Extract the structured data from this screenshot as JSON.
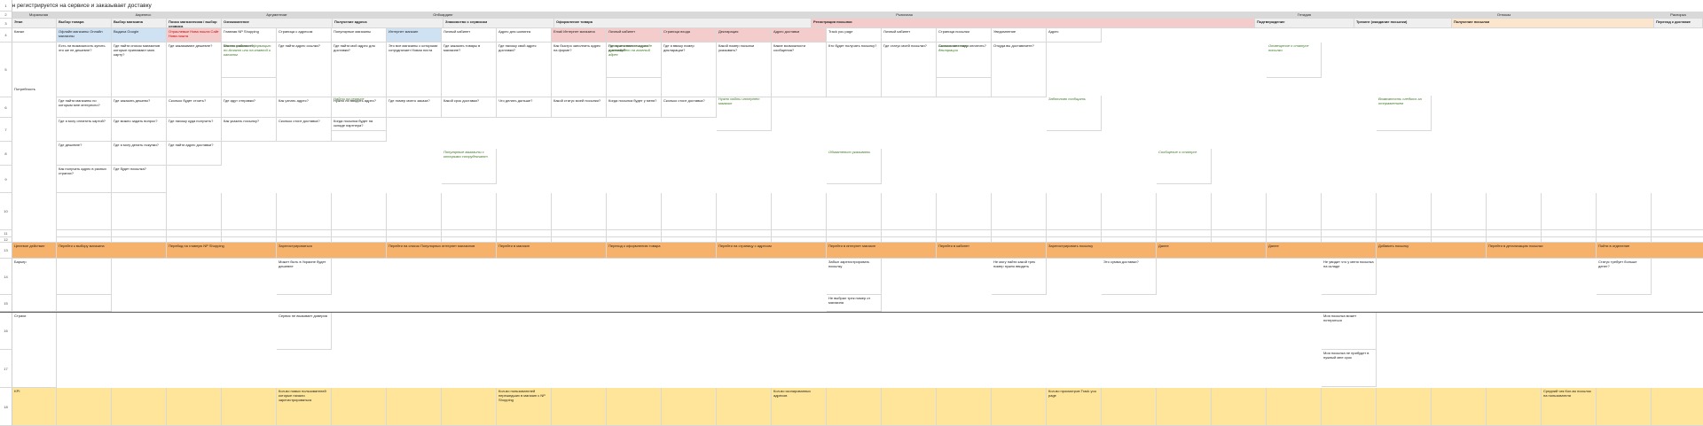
{
  "title": "Иван регистрируется на сервисе и заказывает доставку",
  "row_numbers": [
    "1",
    "2",
    "3",
    "4",
    "5",
    "6",
    "7",
    "8",
    "9",
    "10",
    "11",
    "12",
    "13",
    "14",
    "15",
    "16",
    "17",
    "18",
    "19",
    "20"
  ],
  "stages": [
    {
      "label": "Моральная"
    },
    {
      "label": "Ааренесс"
    },
    {
      "label": "Аргументиат"
    },
    {
      "label": "Онбоардинг"
    },
    {
      "label": "Рыночная"
    },
    {
      "label": "Гнтидия"
    },
    {
      "label": "Отпоказ"
    },
    {
      "label": "Распорка"
    }
  ],
  "substages": [
    "Этап",
    "Выбор товара",
    "Выбор магазина",
    "Поиск магазинчика / выбор сервиса",
    "Ознакомление",
    "Получение адреса",
    "Знакомство с сервисом",
    "Оформление товара",
    "Регистрация посылки",
    "Подтверждение",
    "Трекинг (ожидание посылки)",
    "Получение посылки",
    "Переход к доставке"
  ],
  "channel": {
    "label": "Канал",
    "cells": [
      "Офлайн магазины Онлайн магазины",
      "Выдача Google",
      "Отраслевые Нова пошта Сайт Нова пошта",
      "Главная NP Shopping",
      "Страница с адресом",
      "Популярные магазины",
      "Интернет магазин",
      "Личный кабинет",
      "Адрес для шопинга",
      "Email Интернет магазина",
      "Личный кабинет",
      "Страница входа",
      "Декларация",
      "Адрес доставки",
      "Track you page",
      "Личный кабинет",
      "Страница посылки",
      "Уведомление",
      "Адрес"
    ]
  },
  "needs": {
    "label": "Потребность",
    "rows": [
      [
        "Есть ли возможность купить это же не дешевле?",
        "Где найти список магазинов которые принимают мою карту?",
        "Где заказывают дешевле?",
        "Как это работает?",
        "Где найти адрес ссылки?",
        "Где найти мой адрес для доставки?",
        "Это все магазины с которыми сотрудничает Новая почта",
        "Где заказать товары в магазине?",
        "Где нахожу свой адрес доставки?",
        "Как быстро заполнить адрес на форме?",
        "Где нужно ввести адрес доставки?",
        "Где я ввожу номер декларации?",
        "Какой номер посылки указывать?",
        "Какие возможности сообщения?",
        "Кто будет получать посылку?",
        "Где статус моей посылки?",
        "Сколько мне надо оплатить?",
        "Откуда вы доставляете?"
      ],
      [
        "Где найти магазины по которым мне интересно?",
        "Где заказать дешево?",
        "Сколько будет стоить?",
        "Где идут отправки?",
        "Как узнать адрес?",
        "Нужно ли вводить адрес?",
        "Где номер моего заказа?",
        "Какой срок доставки?",
        "Что делать дальше?",
        "Какой статус моей посылки?",
        "Когда посылка будет у меня?",
        "Сколько стоит доставка?"
      ],
      [
        "Где я могу оплатить картой?",
        "Где можно задать вопрос?",
        "Где нахожу куда получить?",
        "Как указать посылку?",
        "Сколько стоит доставка?",
        "Когда посылка будет на складе партнера?"
      ],
      [
        "Где дешевле?",
        "Где я могу делать покупки?",
        "Где найти адрес доставки?"
      ],
      [
        "Как получать адрес в разных странах?",
        "Где будет посылка?"
      ]
    ]
  },
  "notes": [
    "Можно искать информацию по Amazon или на главной и каталог",
    "Найти на сервисе",
    "Популярные магазины с которыми сотрудничают",
    "На ваше место на складе нужно будет на главный адрес",
    "Нужно найти интернет магазин",
    "Обязательно указывать",
    "Заполните номер декларации",
    "Заботливо сообщать",
    "Сообщение о статусе",
    "Оповещение о статусе посылки",
    "Возможность следить за отправлением"
  ],
  "actions": {
    "label": "Целевое действие",
    "cells": [
      "Перейти к выбору магазина",
      "Перейод на главную NP Shopping",
      "Зарегистрироваться",
      "Перейти на список Популярных интернет магазинов",
      "Перейти в магазин",
      "Переход к оформлению товара",
      "Перейти на страницу с адресом",
      "Перейти в интернет магазин",
      "Перейти в кабинет",
      "Зарегистрировать посылку",
      "Далее",
      "Далее",
      "Добавить посылку",
      "Перейти в детализацию посылки",
      "Пойти в отделение"
    ]
  },
  "barriers": {
    "label": "Барьер",
    "cells": [
      "Может быть в Украине будет дешевле",
      "Забыл зарегистрировать посылку",
      "Не могу найти какой трек номер нужно вводить",
      "Это сумма доставки?",
      "Не увидит что у меня посылка на складе",
      "Статус требует больше денег?",
      "Не выбрал трек номер от магазина"
    ]
  },
  "fears": {
    "label": "Страхи",
    "cells": [
      "Сервис не вызывает доверия",
      "Моя посылка может потеряться",
      "Моя посылка не прибудет в нужный мне срок"
    ]
  },
  "kpi": {
    "label": "KPI",
    "cells": [
      "Кол-во новых пользователей которые начали зарегистрироваться",
      "Кол-во пользователей перешедших в магазин с NP Shopping",
      "Кол-во скопированных адресов",
      "Кол-во просмотров Track you page",
      "Средний чек Кол-во посылок на пользователя",
      "Переходы в магазины"
    ]
  }
}
